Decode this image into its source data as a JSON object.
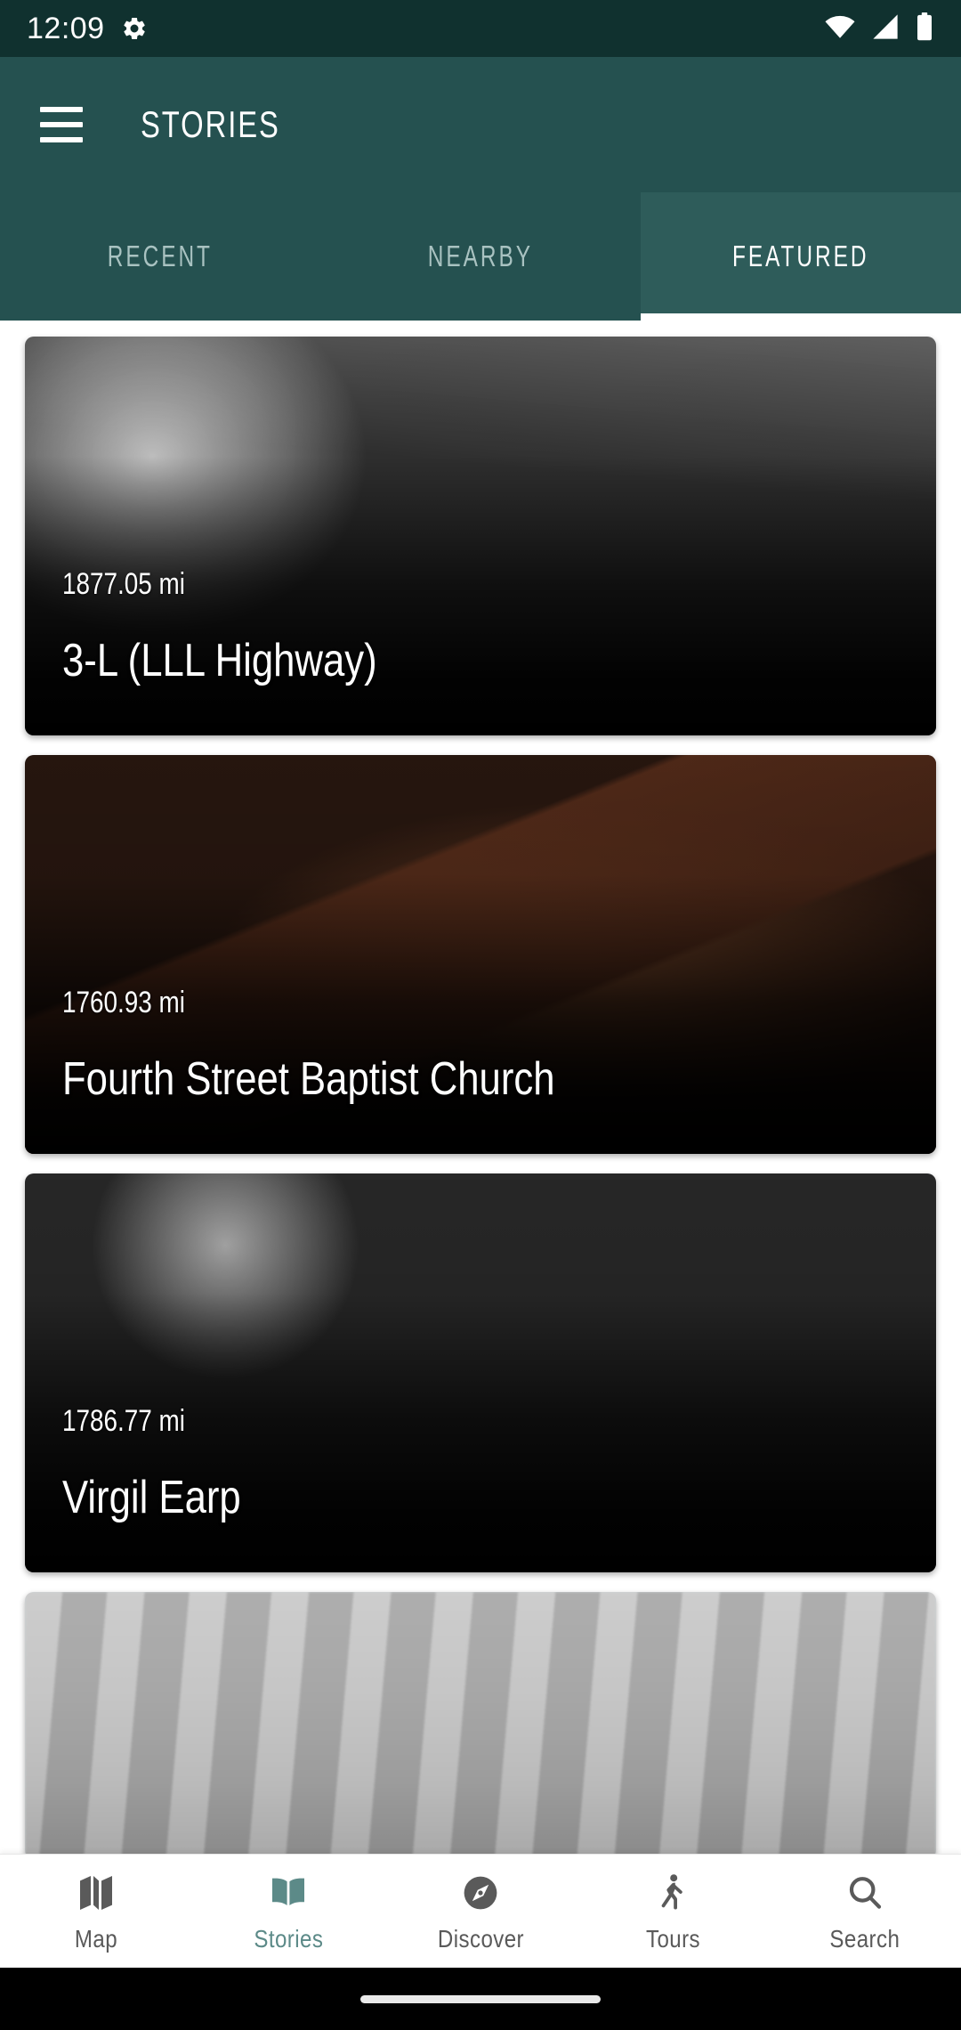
{
  "status_bar": {
    "time": "12:09",
    "icons": [
      "gear-icon",
      "wifi-icon",
      "cellular-signal-icon",
      "battery-icon"
    ]
  },
  "app_bar": {
    "menu_icon": "hamburger-menu-icon",
    "title": "STORIES"
  },
  "tabs": {
    "selected": "FEATURED",
    "items": [
      {
        "label": "RECENT",
        "selected": false
      },
      {
        "label": "NEARBY",
        "selected": false
      },
      {
        "label": "FEATURED",
        "selected": true
      }
    ]
  },
  "stories": [
    {
      "distance": "1877.05 mi",
      "title": "3-L (LLL Highway)",
      "image": "historic-street-buildings-photo"
    },
    {
      "distance": "1760.93 mi",
      "title": "Fourth Street Baptist Church",
      "image": "brick-church-exterior-photo"
    },
    {
      "distance": "1786.77 mi",
      "title": "1786.77",
      "title_text": "Virgil Earp",
      "image": "virgil-earp-portrait-photo"
    },
    {
      "distance": "",
      "title": "",
      "image": "vintage-group-portrait-photo"
    }
  ],
  "bottom_nav": {
    "active": "Stories",
    "items": [
      {
        "label": "Map",
        "icon": "map-icon",
        "active": false
      },
      {
        "label": "Stories",
        "icon": "open-book-icon",
        "active": true
      },
      {
        "label": "Discover",
        "icon": "compass-icon",
        "active": false
      },
      {
        "label": "Tours",
        "icon": "walking-person-icon",
        "active": false
      },
      {
        "label": "Search",
        "icon": "search-icon",
        "active": false
      }
    ]
  },
  "colors": {
    "status_bar_bg": "#10312f",
    "app_bar_bg": "#255150",
    "tab_selected_bg": "#2e5c5a",
    "accent": "#5c8a88",
    "nav_inactive": "#5a5a5a",
    "page_bg": "#ffffff"
  }
}
